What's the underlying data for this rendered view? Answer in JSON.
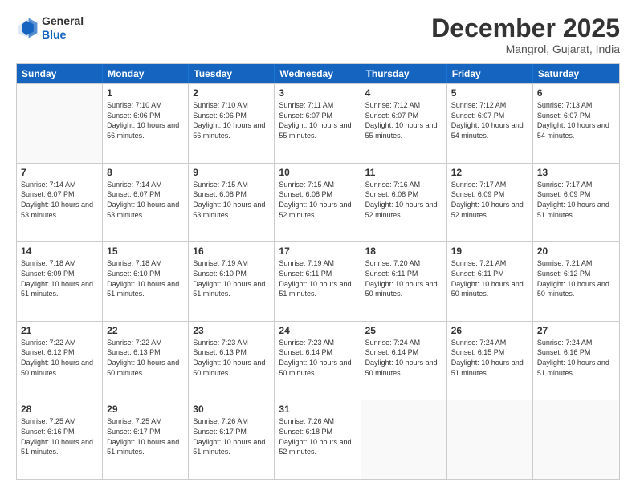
{
  "logo": {
    "general": "General",
    "blue": "Blue"
  },
  "header": {
    "month_year": "December 2025",
    "location": "Mangrol, Gujarat, India"
  },
  "weekdays": [
    "Sunday",
    "Monday",
    "Tuesday",
    "Wednesday",
    "Thursday",
    "Friday",
    "Saturday"
  ],
  "weeks": [
    [
      {
        "day": "",
        "sunrise": "",
        "sunset": "",
        "daylight": ""
      },
      {
        "day": "1",
        "sunrise": "Sunrise: 7:10 AM",
        "sunset": "Sunset: 6:06 PM",
        "daylight": "Daylight: 10 hours and 56 minutes."
      },
      {
        "day": "2",
        "sunrise": "Sunrise: 7:10 AM",
        "sunset": "Sunset: 6:06 PM",
        "daylight": "Daylight: 10 hours and 56 minutes."
      },
      {
        "day": "3",
        "sunrise": "Sunrise: 7:11 AM",
        "sunset": "Sunset: 6:07 PM",
        "daylight": "Daylight: 10 hours and 55 minutes."
      },
      {
        "day": "4",
        "sunrise": "Sunrise: 7:12 AM",
        "sunset": "Sunset: 6:07 PM",
        "daylight": "Daylight: 10 hours and 55 minutes."
      },
      {
        "day": "5",
        "sunrise": "Sunrise: 7:12 AM",
        "sunset": "Sunset: 6:07 PM",
        "daylight": "Daylight: 10 hours and 54 minutes."
      },
      {
        "day": "6",
        "sunrise": "Sunrise: 7:13 AM",
        "sunset": "Sunset: 6:07 PM",
        "daylight": "Daylight: 10 hours and 54 minutes."
      }
    ],
    [
      {
        "day": "7",
        "sunrise": "Sunrise: 7:14 AM",
        "sunset": "Sunset: 6:07 PM",
        "daylight": "Daylight: 10 hours and 53 minutes."
      },
      {
        "day": "8",
        "sunrise": "Sunrise: 7:14 AM",
        "sunset": "Sunset: 6:07 PM",
        "daylight": "Daylight: 10 hours and 53 minutes."
      },
      {
        "day": "9",
        "sunrise": "Sunrise: 7:15 AM",
        "sunset": "Sunset: 6:08 PM",
        "daylight": "Daylight: 10 hours and 53 minutes."
      },
      {
        "day": "10",
        "sunrise": "Sunrise: 7:15 AM",
        "sunset": "Sunset: 6:08 PM",
        "daylight": "Daylight: 10 hours and 52 minutes."
      },
      {
        "day": "11",
        "sunrise": "Sunrise: 7:16 AM",
        "sunset": "Sunset: 6:08 PM",
        "daylight": "Daylight: 10 hours and 52 minutes."
      },
      {
        "day": "12",
        "sunrise": "Sunrise: 7:17 AM",
        "sunset": "Sunset: 6:09 PM",
        "daylight": "Daylight: 10 hours and 52 minutes."
      },
      {
        "day": "13",
        "sunrise": "Sunrise: 7:17 AM",
        "sunset": "Sunset: 6:09 PM",
        "daylight": "Daylight: 10 hours and 51 minutes."
      }
    ],
    [
      {
        "day": "14",
        "sunrise": "Sunrise: 7:18 AM",
        "sunset": "Sunset: 6:09 PM",
        "daylight": "Daylight: 10 hours and 51 minutes."
      },
      {
        "day": "15",
        "sunrise": "Sunrise: 7:18 AM",
        "sunset": "Sunset: 6:10 PM",
        "daylight": "Daylight: 10 hours and 51 minutes."
      },
      {
        "day": "16",
        "sunrise": "Sunrise: 7:19 AM",
        "sunset": "Sunset: 6:10 PM",
        "daylight": "Daylight: 10 hours and 51 minutes."
      },
      {
        "day": "17",
        "sunrise": "Sunrise: 7:19 AM",
        "sunset": "Sunset: 6:11 PM",
        "daylight": "Daylight: 10 hours and 51 minutes."
      },
      {
        "day": "18",
        "sunrise": "Sunrise: 7:20 AM",
        "sunset": "Sunset: 6:11 PM",
        "daylight": "Daylight: 10 hours and 50 minutes."
      },
      {
        "day": "19",
        "sunrise": "Sunrise: 7:21 AM",
        "sunset": "Sunset: 6:11 PM",
        "daylight": "Daylight: 10 hours and 50 minutes."
      },
      {
        "day": "20",
        "sunrise": "Sunrise: 7:21 AM",
        "sunset": "Sunset: 6:12 PM",
        "daylight": "Daylight: 10 hours and 50 minutes."
      }
    ],
    [
      {
        "day": "21",
        "sunrise": "Sunrise: 7:22 AM",
        "sunset": "Sunset: 6:12 PM",
        "daylight": "Daylight: 10 hours and 50 minutes."
      },
      {
        "day": "22",
        "sunrise": "Sunrise: 7:22 AM",
        "sunset": "Sunset: 6:13 PM",
        "daylight": "Daylight: 10 hours and 50 minutes."
      },
      {
        "day": "23",
        "sunrise": "Sunrise: 7:23 AM",
        "sunset": "Sunset: 6:13 PM",
        "daylight": "Daylight: 10 hours and 50 minutes."
      },
      {
        "day": "24",
        "sunrise": "Sunrise: 7:23 AM",
        "sunset": "Sunset: 6:14 PM",
        "daylight": "Daylight: 10 hours and 50 minutes."
      },
      {
        "day": "25",
        "sunrise": "Sunrise: 7:24 AM",
        "sunset": "Sunset: 6:14 PM",
        "daylight": "Daylight: 10 hours and 50 minutes."
      },
      {
        "day": "26",
        "sunrise": "Sunrise: 7:24 AM",
        "sunset": "Sunset: 6:15 PM",
        "daylight": "Daylight: 10 hours and 51 minutes."
      },
      {
        "day": "27",
        "sunrise": "Sunrise: 7:24 AM",
        "sunset": "Sunset: 6:16 PM",
        "daylight": "Daylight: 10 hours and 51 minutes."
      }
    ],
    [
      {
        "day": "28",
        "sunrise": "Sunrise: 7:25 AM",
        "sunset": "Sunset: 6:16 PM",
        "daylight": "Daylight: 10 hours and 51 minutes."
      },
      {
        "day": "29",
        "sunrise": "Sunrise: 7:25 AM",
        "sunset": "Sunset: 6:17 PM",
        "daylight": "Daylight: 10 hours and 51 minutes."
      },
      {
        "day": "30",
        "sunrise": "Sunrise: 7:26 AM",
        "sunset": "Sunset: 6:17 PM",
        "daylight": "Daylight: 10 hours and 51 minutes."
      },
      {
        "day": "31",
        "sunrise": "Sunrise: 7:26 AM",
        "sunset": "Sunset: 6:18 PM",
        "daylight": "Daylight: 10 hours and 52 minutes."
      },
      {
        "day": "",
        "sunrise": "",
        "sunset": "",
        "daylight": ""
      },
      {
        "day": "",
        "sunrise": "",
        "sunset": "",
        "daylight": ""
      },
      {
        "day": "",
        "sunrise": "",
        "sunset": "",
        "daylight": ""
      }
    ]
  ]
}
